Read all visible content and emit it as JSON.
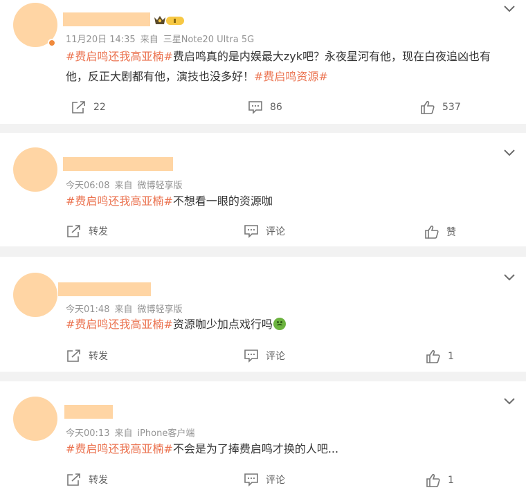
{
  "colors": {
    "background": "#f2f2f2",
    "card": "#ffffff",
    "avatar_placeholder": "#ffd5a4",
    "hashtag": "#eb7350",
    "meta_text": "#939393",
    "body_text": "#333333"
  },
  "posts": [
    {
      "time": "11月20日 14:35",
      "source_prefix": "来自",
      "source": "三星Note20 Ultra 5G",
      "hashtag": "#费启鸣还我高亚楠#",
      "content": "费启鸣真的是内娱最大zyk吧？永夜星河有他，现在白夜追凶也有他，反正大剧都有他，演技也没多好！",
      "hashtag2": "#费启鸣资源#",
      "repost": "22",
      "comment": "86",
      "like": "537",
      "vip_badge_icon": "crown-vip-badge-icon"
    },
    {
      "time": "今天06:08",
      "source_prefix": "来自",
      "source": "微博轻享版",
      "hashtag": "#费启鸣还我高亚楠#",
      "content": "不想看一眼的资源咖",
      "repost": "转发",
      "comment": "评论",
      "like": "赞"
    },
    {
      "time": "今天01:48",
      "source_prefix": "来自",
      "source": "微博轻享版",
      "hashtag": "#费启鸣还我高亚楠#",
      "content": "资源咖少加点戏行吗",
      "emoji_icon": "nauseated-face-emoji-icon",
      "repost": "转发",
      "comment": "评论",
      "like": "1"
    },
    {
      "time": "今天00:13",
      "source_prefix": "来自",
      "source": "iPhone客户端",
      "hashtag": "#费启鸣还我高亚楠#",
      "content": "不会是为了捧费启鸣才换的人吧...",
      "repost": "转发",
      "comment": "评论",
      "like": "1"
    }
  ]
}
